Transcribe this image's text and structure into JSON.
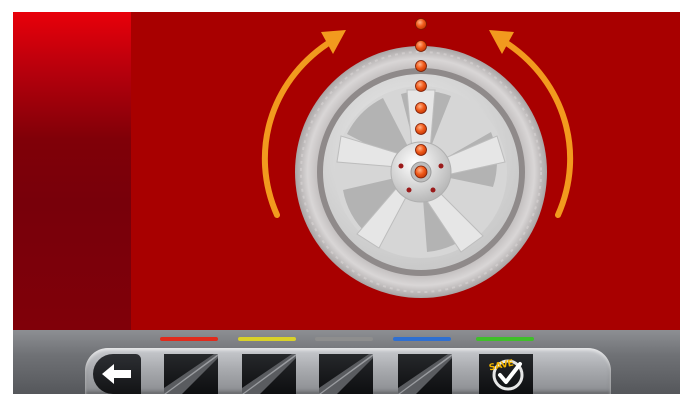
{
  "toolbar": {
    "indicators": [
      {
        "name": "red",
        "color": "#e02a1c"
      },
      {
        "name": "yellow",
        "color": "#d9d12a"
      },
      {
        "name": "gray",
        "color": "#8e8e8e"
      },
      {
        "name": "blue",
        "color": "#2f6fd1"
      },
      {
        "name": "green",
        "color": "#3fbf2a"
      }
    ],
    "back_icon": "arrow-left-icon",
    "softkey_icon": "diagonal-slash-icon",
    "save_label": "SAVE",
    "save_icon": "checkmark-circle-icon"
  },
  "main": {
    "background": "#a80000",
    "wheel_icon": "wheel-icon",
    "rotation_arrows_icon": "rotate-arrow-icon",
    "arrow_color": "#f29a1e",
    "dot_color": "#f05a1a"
  },
  "sidebar": {
    "background": "#800008"
  }
}
